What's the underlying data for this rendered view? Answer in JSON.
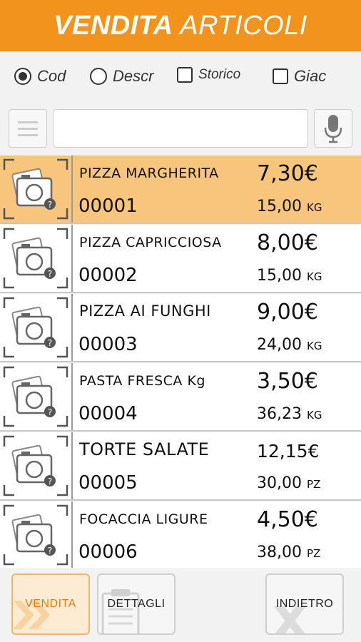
{
  "header": {
    "title_bold": "VENDITA",
    "title_light": "ARTICOLI",
    "color": "#f1931c"
  },
  "filters": {
    "cod": {
      "label": "Cod",
      "selected": true
    },
    "descr": {
      "label": "Descr",
      "selected": false
    },
    "storico": {
      "label": "Storico",
      "checked": false
    },
    "giac": {
      "label": "Giac",
      "checked": false
    }
  },
  "search": {
    "value": "",
    "placeholder": ""
  },
  "items": [
    {
      "name": "PIZZA MARGHERITA",
      "code": "00001",
      "price": "7,30€",
      "stock": "15,00",
      "unit": "KG",
      "selected": true
    },
    {
      "name": "PIZZA CAPRICCIOSA",
      "code": "00002",
      "price": "8,00€",
      "stock": "15,00",
      "unit": "KG"
    },
    {
      "name": "PIZZA AI FUNGHI",
      "code": "00003",
      "price": "9,00€",
      "stock": "24,00",
      "unit": "KG"
    },
    {
      "name": "PASTA FRESCA Kg",
      "code": "00004",
      "price": "3,50€",
      "stock": "36,23",
      "unit": "KG"
    },
    {
      "name": "TORTE SALATE",
      "code": "00005",
      "price": "12,15€",
      "stock": "30,00",
      "unit": "PZ"
    },
    {
      "name": "FOCACCIA LIGURE",
      "code": "00006",
      "price": "4,50€",
      "stock": "38,00",
      "unit": "PZ"
    }
  ],
  "footer": {
    "vendita_label": "VENDITA",
    "dettagli_label": "DETTAGLI",
    "indietro_label": "INDIETRO"
  }
}
